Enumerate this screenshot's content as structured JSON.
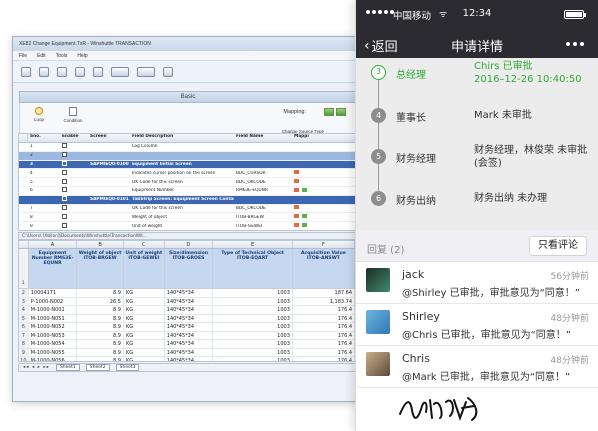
{
  "desktop": {
    "window_title": "XE82 Change Equipment.TxR - Winshuttle TRANSACTION",
    "menu": [
      "File",
      "Edit",
      "Tools",
      "Help"
    ],
    "tab_basic": "Basic",
    "loop_label": "Loop",
    "condition_label": "Condition",
    "mapping_label": "Mapping:",
    "change_source_label": "Change Source Type",
    "mapping_grid": {
      "headers": [
        "Sno.",
        "Enable",
        "Screen",
        "Field Description",
        "Field Name",
        "Mappi"
      ],
      "rows": [
        {
          "n": "1",
          "screen": "",
          "desc": "Log Column",
          "field": "",
          "style": "plain"
        },
        {
          "n": "2",
          "screen": "",
          "desc": "",
          "field": "",
          "style": "sel"
        },
        {
          "n": "3",
          "screen": "SAPMIEQ0-0100",
          "desc": "Equipment Initial Screen",
          "field": "",
          "style": "blue"
        },
        {
          "n": "4",
          "screen": "",
          "desc": "Indicates cursor position on the screen",
          "field": "BDC_CURSOR",
          "style": "plain"
        },
        {
          "n": "5",
          "screen": "",
          "desc": "OK Code for this screen",
          "field": "BDC_OKCODE",
          "style": "plain"
        },
        {
          "n": "6",
          "screen": "",
          "desc": "Equipment Number",
          "field": "RM63E-EQUNR",
          "style": "plain"
        },
        {
          "n": "",
          "screen": "SAPMIEQ0-0101",
          "desc": "TabStrip Screen: Equipment Screen Container",
          "field": "",
          "style": "blue"
        },
        {
          "n": "7",
          "screen": "",
          "desc": "OK Code for this screen",
          "field": "BDC_OKCODE",
          "style": "plain"
        },
        {
          "n": "8",
          "screen": "",
          "desc": "Weight of object",
          "field": "ITOB-BRGEW",
          "style": "plain"
        },
        {
          "n": "9",
          "screen": "",
          "desc": "Unit of weight",
          "field": "ITOB-GEWEI",
          "style": "plain"
        }
      ]
    },
    "excel_path": "C:\\Users\\ [Xbilon]\\Documents\\Winshuttle\\TransactionWit...",
    "excel": {
      "cols": [
        "A",
        "B",
        "C",
        "D",
        "E",
        "F"
      ],
      "headers": [
        "Equipment Number RM63E-EQUNR",
        "Weight of object ITOB-BRGEW",
        "Unit of weight ITOB-GEWEI",
        "Size/dimension ITOB-GROES",
        "Type of Technical Object ITOB-EQART",
        "Acquisition Value ITOB-ANSWT"
      ],
      "rows": [
        [
          "2",
          "10004171",
          "8.9",
          "KG",
          "140*45*34",
          "1003",
          "187.64"
        ],
        [
          "3",
          "P-1000-N002",
          "26.5",
          "KG",
          "140*45*34",
          "1003",
          "1,183.74"
        ],
        [
          "4",
          "M-1000-N001",
          "8.9",
          "KG",
          "140*45*34",
          "1003",
          "176.4"
        ],
        [
          "5",
          "M-1000-N051",
          "8.9",
          "KG",
          "140*45*34",
          "1003",
          "176.4"
        ],
        [
          "6",
          "M-1000-N052",
          "8.9",
          "KG",
          "140*45*34",
          "1003",
          "176.4"
        ],
        [
          "7",
          "M-1000-N053",
          "8.9",
          "KG",
          "140*45*34",
          "1003",
          "176.4"
        ],
        [
          "8",
          "M-1000-N054",
          "8.9",
          "KG",
          "140*45*34",
          "1003",
          "176.4"
        ],
        [
          "9",
          "M-1000-N055",
          "8.9",
          "KG",
          "140*45*34",
          "1003",
          "176.4"
        ],
        [
          "10",
          "M-1000-N056",
          "8.9",
          "KG",
          "140*45*34",
          "1003",
          "176.4"
        ],
        [
          "11",
          "M-1000-N057",
          "8.9",
          "KG",
          "140*45*34",
          "1003",
          "176.4"
        ]
      ]
    },
    "sheets": [
      "Sheet1",
      "Sheet2",
      "Sheet3"
    ]
  },
  "phone": {
    "carrier": "中国移动",
    "wifi": "ᯤ",
    "time": "12:34",
    "back_label": "返回",
    "nav_title": "申请详情",
    "steps": [
      {
        "num": "3",
        "role": "总经理",
        "info": "Chirs 已审批\n2016–12-26 10:40:50",
        "active": true
      },
      {
        "num": "4",
        "role": "董事长",
        "info": "Mark 未审批",
        "active": false
      },
      {
        "num": "5",
        "role": "财务经理",
        "info": "财务经理，林俊荣 未审批(会签)",
        "active": false
      },
      {
        "num": "6",
        "role": "财务出纳",
        "info": "财务出纳 未办理",
        "active": false
      }
    ],
    "reply_count": "回复 (2)",
    "only_comments": "只看评论",
    "comments": [
      {
        "name": "jack",
        "time": "56分钟前",
        "text": "@Shirley 已审批，审批意见为“同意！”",
        "avatar": "jack-avatar"
      },
      {
        "name": "Shirley",
        "time": "48分钟前",
        "text": "@Chris 已审批，审批意见为“同意！”",
        "avatar": "shirley-avatar"
      },
      {
        "name": "Chris",
        "time": "48分钟前",
        "text": "@Mark 已审批，审批意见为“同意！”",
        "avatar": "chris-avatar"
      }
    ],
    "colors": {
      "approved_green": "#2dab36",
      "nav_dark": "#2b2b31"
    }
  }
}
